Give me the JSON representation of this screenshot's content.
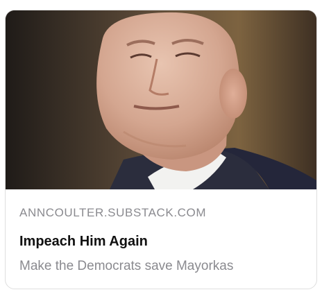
{
  "link_preview": {
    "image": {
      "subject": "portrait-photo",
      "colors": {
        "background_dark": "#2a2520",
        "background_warm": "#7a613f",
        "skin": "#d9b29d",
        "suit": "#2b2d3d",
        "shirt": "#f2f2f0"
      }
    },
    "domain": "ANNCOULTER.SUBSTACK.COM",
    "title": "Impeach Him Again",
    "description": "Make the Democrats save Mayorkas"
  }
}
